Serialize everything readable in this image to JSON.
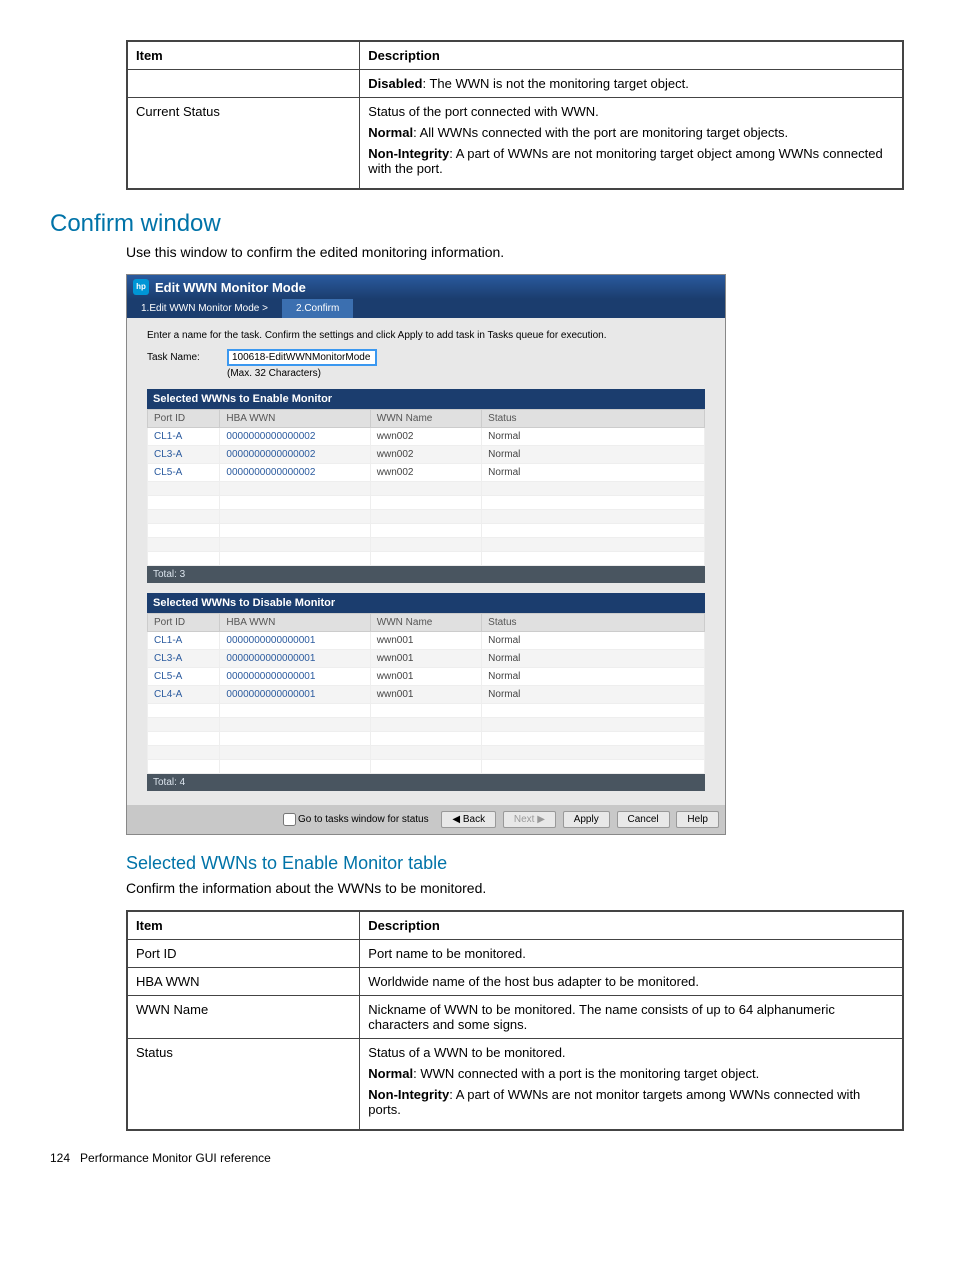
{
  "topTable": {
    "headItem": "Item",
    "headDesc": "Description",
    "row0_desc_bold": "Disabled",
    "row0_desc_rest": ": The WWN is not the monitoring target object.",
    "row1_item": "Current Status",
    "row1_line1": "Status of the port connected with WWN.",
    "row1_line2_bold": "Normal",
    "row1_line2_rest": ": All WWNs connected with the port are monitoring target objects.",
    "row1_line3_bold": "Non-Integrity",
    "row1_line3_rest": ": A part of WWNs are not monitoring target object among WWNs connected with the port."
  },
  "confirm": {
    "heading": "Confirm window",
    "intro": "Use this window to confirm the edited monitoring information."
  },
  "dialog": {
    "title": "Edit WWN Monitor Mode",
    "step1": "1.Edit WWN Monitor Mode  >",
    "step2": "2.Confirm",
    "instruction": "Enter a name for the task. Confirm the settings and click Apply to add task in Tasks queue for execution.",
    "taskNameLabel": "Task Name:",
    "taskNameValue": "100618-EditWWNMonitorMode",
    "taskNameHint": "(Max. 32 Characters)",
    "enable": {
      "title": "Selected WWNs to Enable Monitor",
      "cols": {
        "c1": "Port ID",
        "c2": "HBA WWN",
        "c3": "WWN Name",
        "c4": "Status"
      },
      "rows": [
        {
          "port": "CL1-A",
          "hba": "0000000000000002",
          "wwn": "wwn002",
          "status": "Normal"
        },
        {
          "port": "CL3-A",
          "hba": "0000000000000002",
          "wwn": "wwn002",
          "status": "Normal"
        },
        {
          "port": "CL5-A",
          "hba": "0000000000000002",
          "wwn": "wwn002",
          "status": "Normal"
        }
      ],
      "total": "Total: 3"
    },
    "disable": {
      "title": "Selected WWNs to Disable Monitor",
      "cols": {
        "c1": "Port ID",
        "c2": "HBA WWN",
        "c3": "WWN Name",
        "c4": "Status"
      },
      "rows": [
        {
          "port": "CL1-A",
          "hba": "0000000000000001",
          "wwn": "wwn001",
          "status": "Normal"
        },
        {
          "port": "CL3-A",
          "hba": "0000000000000001",
          "wwn": "wwn001",
          "status": "Normal"
        },
        {
          "port": "CL5-A",
          "hba": "0000000000000001",
          "wwn": "wwn001",
          "status": "Normal"
        },
        {
          "port": "CL4-A",
          "hba": "0000000000000001",
          "wwn": "wwn001",
          "status": "Normal"
        }
      ],
      "total": "Total: 4"
    },
    "footer": {
      "goto": "Go to tasks window for status",
      "back": "◀ Back",
      "next": "Next ▶",
      "apply": "Apply",
      "cancel": "Cancel",
      "help": "Help"
    }
  },
  "sub": {
    "heading": "Selected WWNs to Enable Monitor table",
    "intro": "Confirm the information about the WWNs to be monitored."
  },
  "bottomTable": {
    "headItem": "Item",
    "headDesc": "Description",
    "r1_item": "Port ID",
    "r1_desc": "Port name to be monitored.",
    "r2_item": "HBA WWN",
    "r2_desc": "Worldwide name of the host bus adapter to be monitored.",
    "r3_item": "WWN Name",
    "r3_desc": "Nickname of WWN to be monitored. The name consists of up to 64 alphanumeric characters and some signs.",
    "r4_item": "Status",
    "r4_line1": "Status of a WWN to be monitored.",
    "r4_line2_bold": "Normal",
    "r4_line2_rest": ": WWN connected with a port is the monitoring target object.",
    "r4_line3_bold": "Non-Integrity",
    "r4_line3_rest": ": A part of WWNs are not monitor targets among WWNs connected with ports."
  },
  "footer": {
    "page": "124",
    "title": "Performance Monitor GUI reference"
  }
}
